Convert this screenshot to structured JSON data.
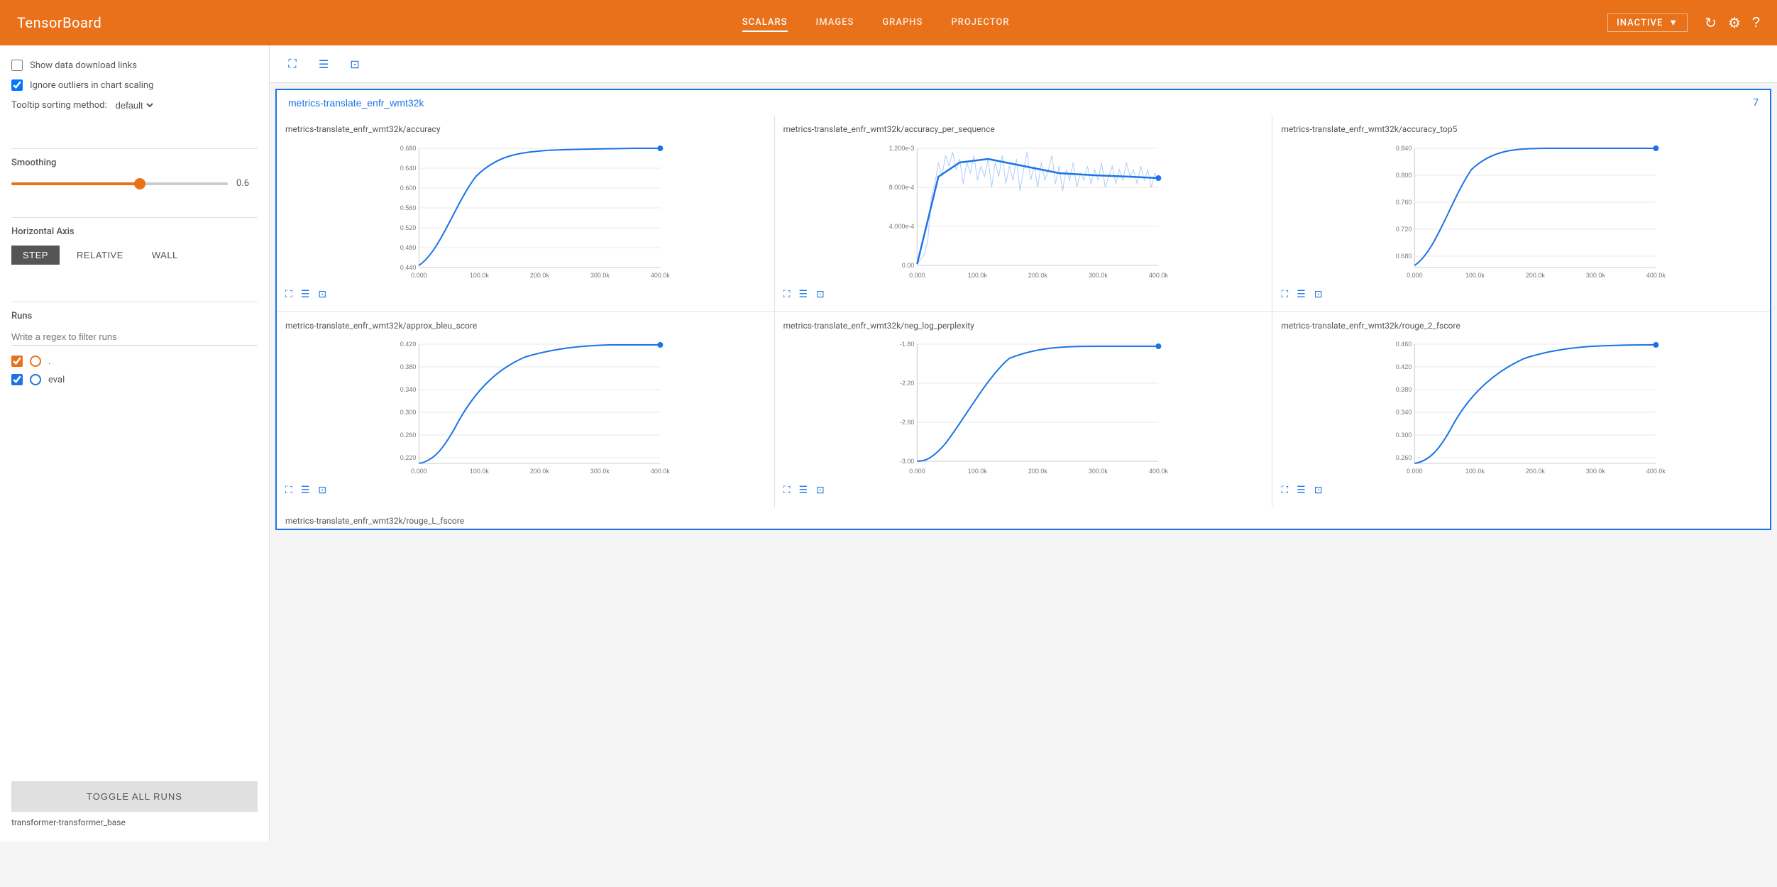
{
  "brand": "TensorBoard",
  "nav": {
    "links": [
      {
        "label": "SCALARS",
        "active": true
      },
      {
        "label": "IMAGES",
        "active": false
      },
      {
        "label": "GRAPHS",
        "active": false
      },
      {
        "label": "PROJECTOR",
        "active": false
      }
    ],
    "inactive_label": "INACTIVE",
    "icons": [
      "refresh-icon",
      "settings-icon",
      "help-icon"
    ]
  },
  "sidebar": {
    "show_download": "Show data download links",
    "ignore_outliers": "Ignore outliers in chart scaling",
    "tooltip_label": "Tooltip sorting method:",
    "tooltip_value": "default",
    "smoothing_label": "Smoothing",
    "smoothing_value": "0.6",
    "smoothing_pct": 60,
    "haxis_label": "Horizontal Axis",
    "haxis_buttons": [
      "STEP",
      "RELATIVE",
      "WALL"
    ],
    "haxis_active": "STEP",
    "runs_label": "Runs",
    "runs_filter_placeholder": "Write a regex to filter runs",
    "runs": [
      {
        "label": ".",
        "checked": true,
        "color": "orange"
      },
      {
        "label": "eval",
        "checked": true,
        "color": "blue"
      }
    ],
    "toggle_all_label": "TOGGLE ALL RUNS",
    "footer_label": "transformer-transformer_base"
  },
  "main": {
    "group_title": "metrics-translate_enfr_wmt32k",
    "group_count": "7",
    "charts": [
      {
        "title": "metrics-translate_enfr_wmt32k/accuracy",
        "y_labels": [
          "0.680",
          "0.640",
          "0.600",
          "0.560",
          "0.520",
          "0.480",
          "0.440"
        ],
        "x_labels": [
          "0.000",
          "100.0k",
          "200.0k",
          "300.0k",
          "400.0k"
        ],
        "type": "curve_up"
      },
      {
        "title": "metrics-translate_enfr_wmt32k/accuracy_per_sequence",
        "y_labels": [
          "1.200e-3",
          "8.000e-4",
          "4.000e-4",
          "0.00"
        ],
        "x_labels": [
          "0.000",
          "100.0k",
          "200.0k",
          "300.0k",
          "400.0k"
        ],
        "type": "noisy"
      },
      {
        "title": "metrics-translate_enfr_wmt32k/accuracy_top5",
        "y_labels": [
          "0.840",
          "0.800",
          "0.760",
          "0.720",
          "0.680"
        ],
        "x_labels": [
          "0.000",
          "100.0k",
          "200.0k",
          "300.0k",
          "400.0k"
        ],
        "type": "curve_up"
      },
      {
        "title": "metrics-translate_enfr_wmt32k/approx_bleu_score",
        "y_labels": [
          "0.420",
          "0.380",
          "0.340",
          "0.300",
          "0.260",
          "0.220"
        ],
        "x_labels": [
          "0.000",
          "100.0k",
          "200.0k",
          "300.0k",
          "400.0k"
        ],
        "type": "curve_up"
      },
      {
        "title": "metrics-translate_enfr_wmt32k/neg_log_perplexity",
        "y_labels": [
          "-1.80",
          "-2.20",
          "-2.60",
          "-3.00"
        ],
        "x_labels": [
          "0.000",
          "100.0k",
          "200.0k",
          "300.0k",
          "400.0k"
        ],
        "type": "curve_up_neg"
      },
      {
        "title": "metrics-translate_enfr_wmt32k/rouge_2_fscore",
        "y_labels": [
          "0.460",
          "0.420",
          "0.380",
          "0.340",
          "0.300",
          "0.260"
        ],
        "x_labels": [
          "0.000",
          "100.0k",
          "200.0k",
          "300.0k",
          "400.0k"
        ],
        "type": "curve_up"
      },
      {
        "title": "metrics-translate_enfr_wmt32k/rouge_L_fscore",
        "y_labels": [],
        "x_labels": [],
        "type": "curve_up"
      }
    ]
  }
}
